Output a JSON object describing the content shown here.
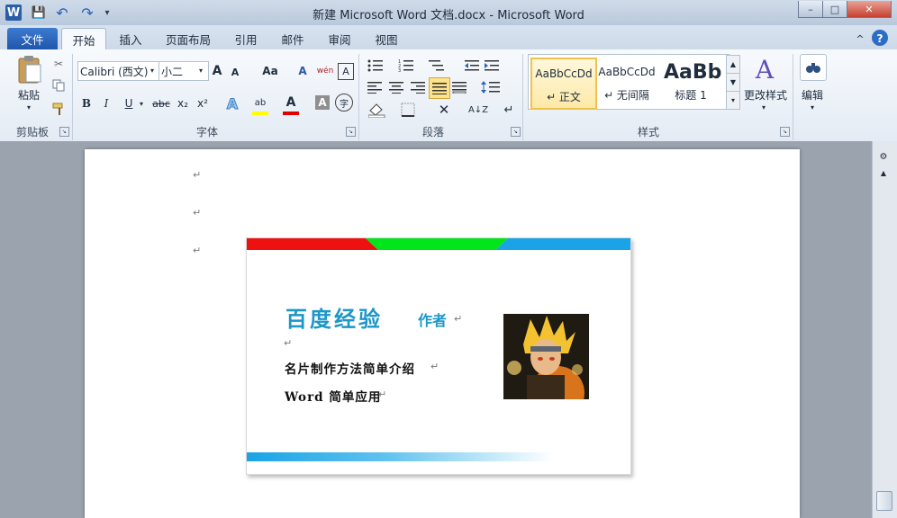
{
  "window": {
    "title": "新建 Microsoft Word 文档.docx  -  Microsoft Word",
    "app_icon": "W",
    "controls": {
      "minimize": "–",
      "maximize": "□",
      "close": "✕"
    }
  },
  "quick_access": {
    "save_icon": "💾",
    "undo_icon": "↶",
    "redo_icon": "↷",
    "more_icon": "▾"
  },
  "tabs": [
    {
      "label": "文件"
    },
    {
      "label": "开始"
    },
    {
      "label": "插入"
    },
    {
      "label": "页面布局"
    },
    {
      "label": "引用"
    },
    {
      "label": "邮件"
    },
    {
      "label": "审阅"
    },
    {
      "label": "视图"
    }
  ],
  "ribbon_right": {
    "collapse": "^",
    "help": "?"
  },
  "clipboard": {
    "paste_label": "粘贴",
    "group_label": "剪贴板"
  },
  "font": {
    "font_name": "Calibri (西文)",
    "font_size": "小二",
    "grow": "A",
    "shrink": "A",
    "change_case": "Aa",
    "clear": "A",
    "wen": "wén",
    "bold": "B",
    "italic": "I",
    "underline": "U",
    "strike": "abc",
    "sub": "x₂",
    "sup": "x²",
    "effects": "A",
    "highlight": "ab",
    "color": "A",
    "shade": "A",
    "enclose": "字",
    "group_label": "字体"
  },
  "paragraph": {
    "group_label": "段落",
    "sort": "A↓Z",
    "show_marks": "↵"
  },
  "styles": {
    "items": [
      {
        "preview": "AaBbCcDd",
        "name": "↵ 正文"
      },
      {
        "preview": "AaBbCcDd",
        "name": "↵ 无间隔"
      },
      {
        "preview": "AaBb",
        "name": "标题 1"
      }
    ],
    "change": "更改样式",
    "group_label": "样式"
  },
  "editing": {
    "label": "编辑"
  },
  "doc": {
    "para_mark": "↵",
    "card": {
      "title": "百度经验",
      "author": "作者",
      "line1": "名片制作方法简单介绍",
      "line2": "Word 简单应用",
      "colors": {
        "red": "#ee1111",
        "green": "#00e61a",
        "blue": "#1aa3e6",
        "title": "#1c97c9"
      }
    }
  }
}
